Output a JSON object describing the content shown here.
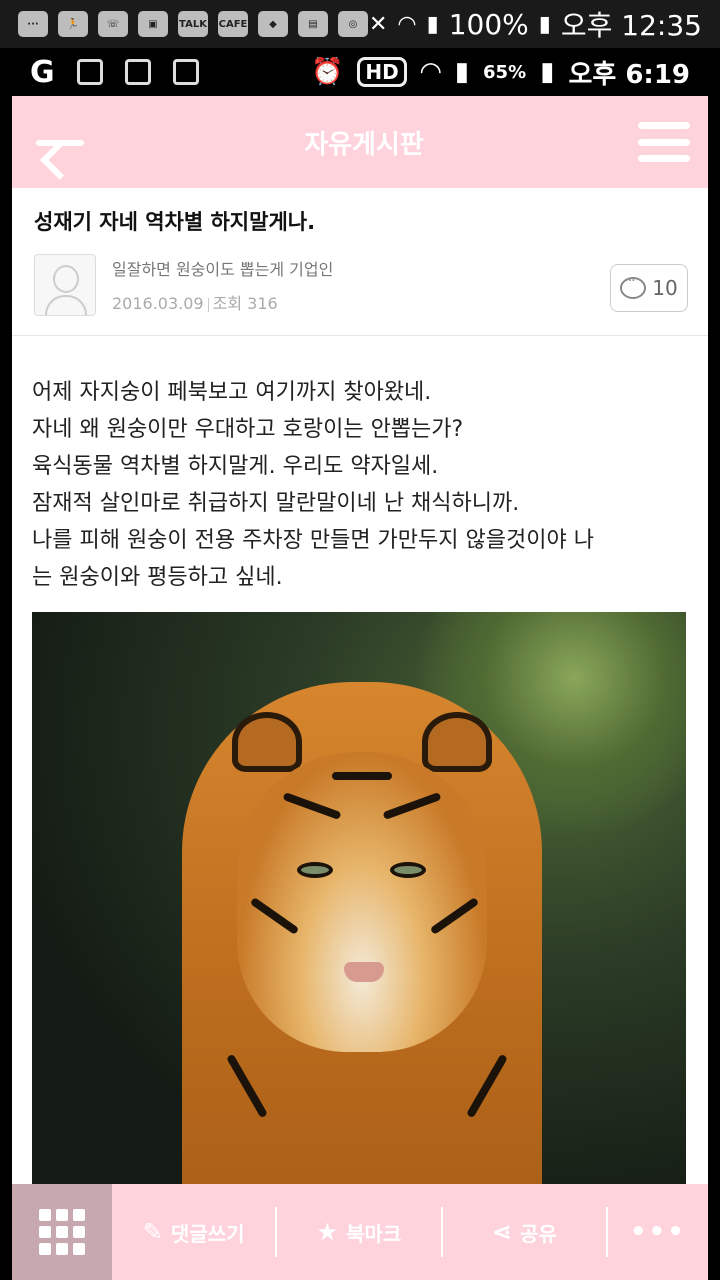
{
  "system_status_bar": {
    "battery": "100%",
    "time": "오후 12:35",
    "left_icons": [
      "TALK",
      "CAFE"
    ]
  },
  "embedded_status_bar": {
    "hd": "HD",
    "battery": "65%",
    "time": "오후 6:19"
  },
  "topbar": {
    "title": "자유게시판"
  },
  "post": {
    "title": "성재기 자네 역차별 하지말게나.",
    "author": "일잘하면 원숭이도 뽑는게 기업인",
    "date": "2016.03.09",
    "views": "조회 316",
    "comments": "10",
    "body_lines": [
      "어제 자지숭이 페북보고 여기까지 찾아왔네.",
      "자네 왜 원숭이만 우대하고 호랑이는 안뽑는가?",
      "육식동물 역차별 하지말게. 우리도 약자일세.",
      "잠재적 살인마로 취급하지 말란말이네 난 채식하니까.",
      "나를 피해 원숭이 전용 주차장 만들면 가만두지 않을것이야 나",
      "는 원숭이와 평등하고 싶네."
    ]
  },
  "bottom_bar": {
    "comment": "댓글쓰기",
    "bookmark": "북마크",
    "share": "공유",
    "more": "•••"
  }
}
